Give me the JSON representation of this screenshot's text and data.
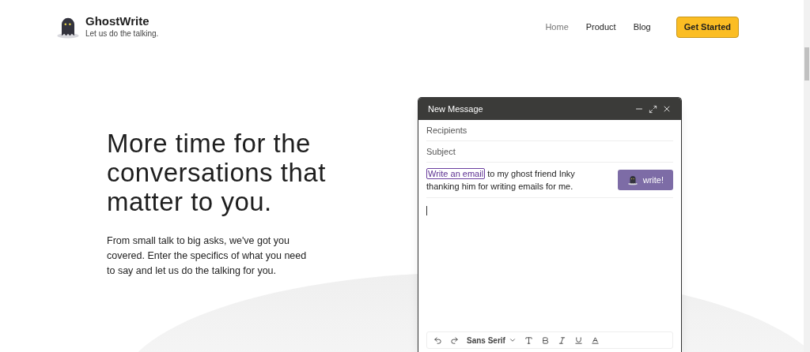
{
  "brand": {
    "name": "GhostWrite",
    "tagline": "Let us do the talking."
  },
  "nav": [
    {
      "label": "Home",
      "selected": true
    },
    {
      "label": "Product",
      "selected": false
    },
    {
      "label": "Blog",
      "selected": false
    }
  ],
  "cta": "Get Started",
  "hero": {
    "heading": "More time for the conversations that matter to you.",
    "body": "From small talk to big asks, we've got you covered. Enter the specifics of what you need to say and let us do the talking for you."
  },
  "compose": {
    "title": "New Message",
    "recipients_placeholder": "Recipients",
    "subject_placeholder": "Subject",
    "prompt_highlight": "Write an email",
    "prompt_rest": "to my ghost friend Inky thanking him for writing emails for me.",
    "write_button": "write!",
    "font": "Sans Serif"
  }
}
